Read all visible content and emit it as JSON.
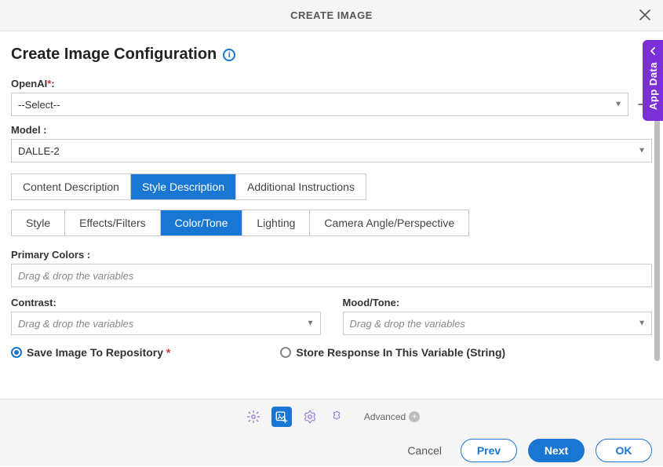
{
  "dialog": {
    "title": "CREATE IMAGE",
    "heading": "Create Image Configuration"
  },
  "side_panel": {
    "label": "App Data"
  },
  "fields": {
    "openai": {
      "label": "OpenAI",
      "required_suffix": ":",
      "value": "--Select--"
    },
    "model": {
      "label": "Model :",
      "value": "DALLE-2"
    },
    "primary_colors": {
      "label": "Primary Colors :",
      "placeholder": "Drag & drop the variables"
    },
    "contrast": {
      "label": "Contrast:",
      "placeholder": "Drag & drop the variables"
    },
    "mood": {
      "label": "Mood/Tone:",
      "placeholder": "Drag & drop the variables"
    }
  },
  "tabs": {
    "main": [
      "Content Description",
      "Style Description",
      "Additional Instructions"
    ],
    "main_active_index": 1,
    "sub": [
      "Style",
      "Effects/Filters",
      "Color/Tone",
      "Lighting",
      "Camera Angle/Perspective"
    ],
    "sub_active_index": 2
  },
  "radios": {
    "save_repo": "Save Image To Repository",
    "store_var": "Store Response In This Variable (String)",
    "checked": "save_repo"
  },
  "footer": {
    "advanced": "Advanced",
    "cancel": "Cancel",
    "prev": "Prev",
    "next": "Next",
    "ok": "OK"
  }
}
